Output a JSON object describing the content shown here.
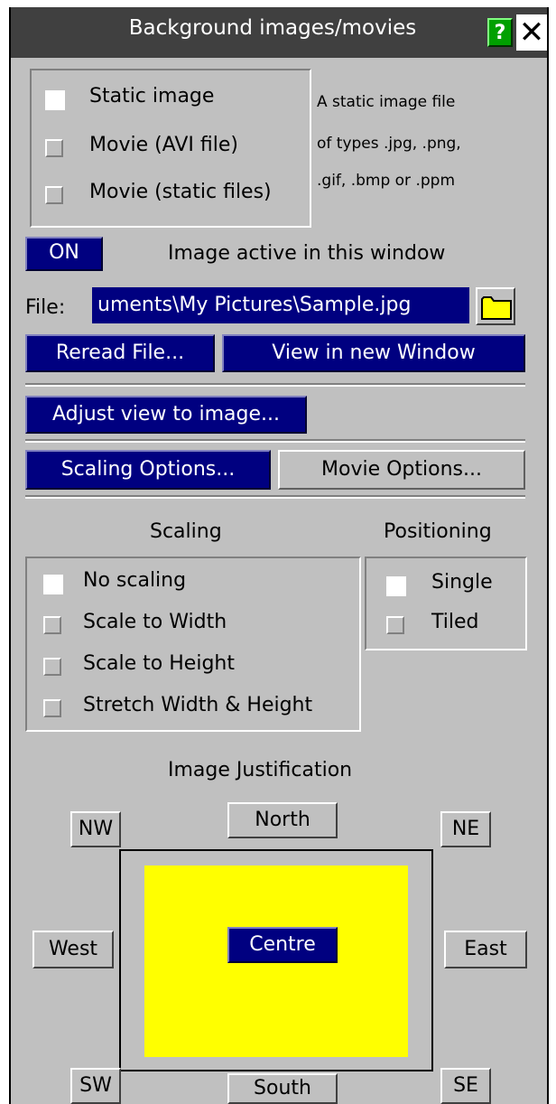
{
  "window": {
    "title": "Background images/movies",
    "help_label": "?",
    "close_label": "✕"
  },
  "source": {
    "options": [
      {
        "label": "Static image",
        "selected": true
      },
      {
        "label": "Movie (AVI file)",
        "selected": false
      },
      {
        "label": "Movie (static files)",
        "selected": false
      }
    ],
    "description_lines": [
      "A static image file",
      "of types .jpg, .png,",
      ".gif, .bmp or .ppm"
    ]
  },
  "active": {
    "toggle_label": "ON",
    "label": "Image active in this window"
  },
  "file": {
    "label": "File:",
    "value": "uments\\My Pictures\\Sample.jpg",
    "folder_icon": "folder-icon"
  },
  "buttons": {
    "reread": "Reread File...",
    "view_new_window": "View in new Window",
    "adjust_view": "Adjust view to image...",
    "scaling_options": "Scaling Options...",
    "movie_options": "Movie Options..."
  },
  "scaling": {
    "heading": "Scaling",
    "options": [
      {
        "label": "No scaling",
        "selected": true
      },
      {
        "label": "Scale to Width",
        "selected": false
      },
      {
        "label": "Scale to Height",
        "selected": false
      },
      {
        "label": "Stretch Width & Height",
        "selected": false
      }
    ]
  },
  "positioning": {
    "heading": "Positioning",
    "options": [
      {
        "label": "Single",
        "selected": true
      },
      {
        "label": "Tiled",
        "selected": false
      }
    ]
  },
  "justification": {
    "heading": "Image Justification",
    "nw": "NW",
    "north": "North",
    "ne": "NE",
    "west": "West",
    "centre": "Centre",
    "east": "East",
    "sw": "SW",
    "south": "South",
    "se": "SE"
  },
  "colors": {
    "panel": "#c0c0c0",
    "title_bar": "#404040",
    "active_blue": "#000080",
    "help_green": "#00a000",
    "folder_yellow": "#ffff00",
    "preview_yellow": "#ffff00"
  }
}
